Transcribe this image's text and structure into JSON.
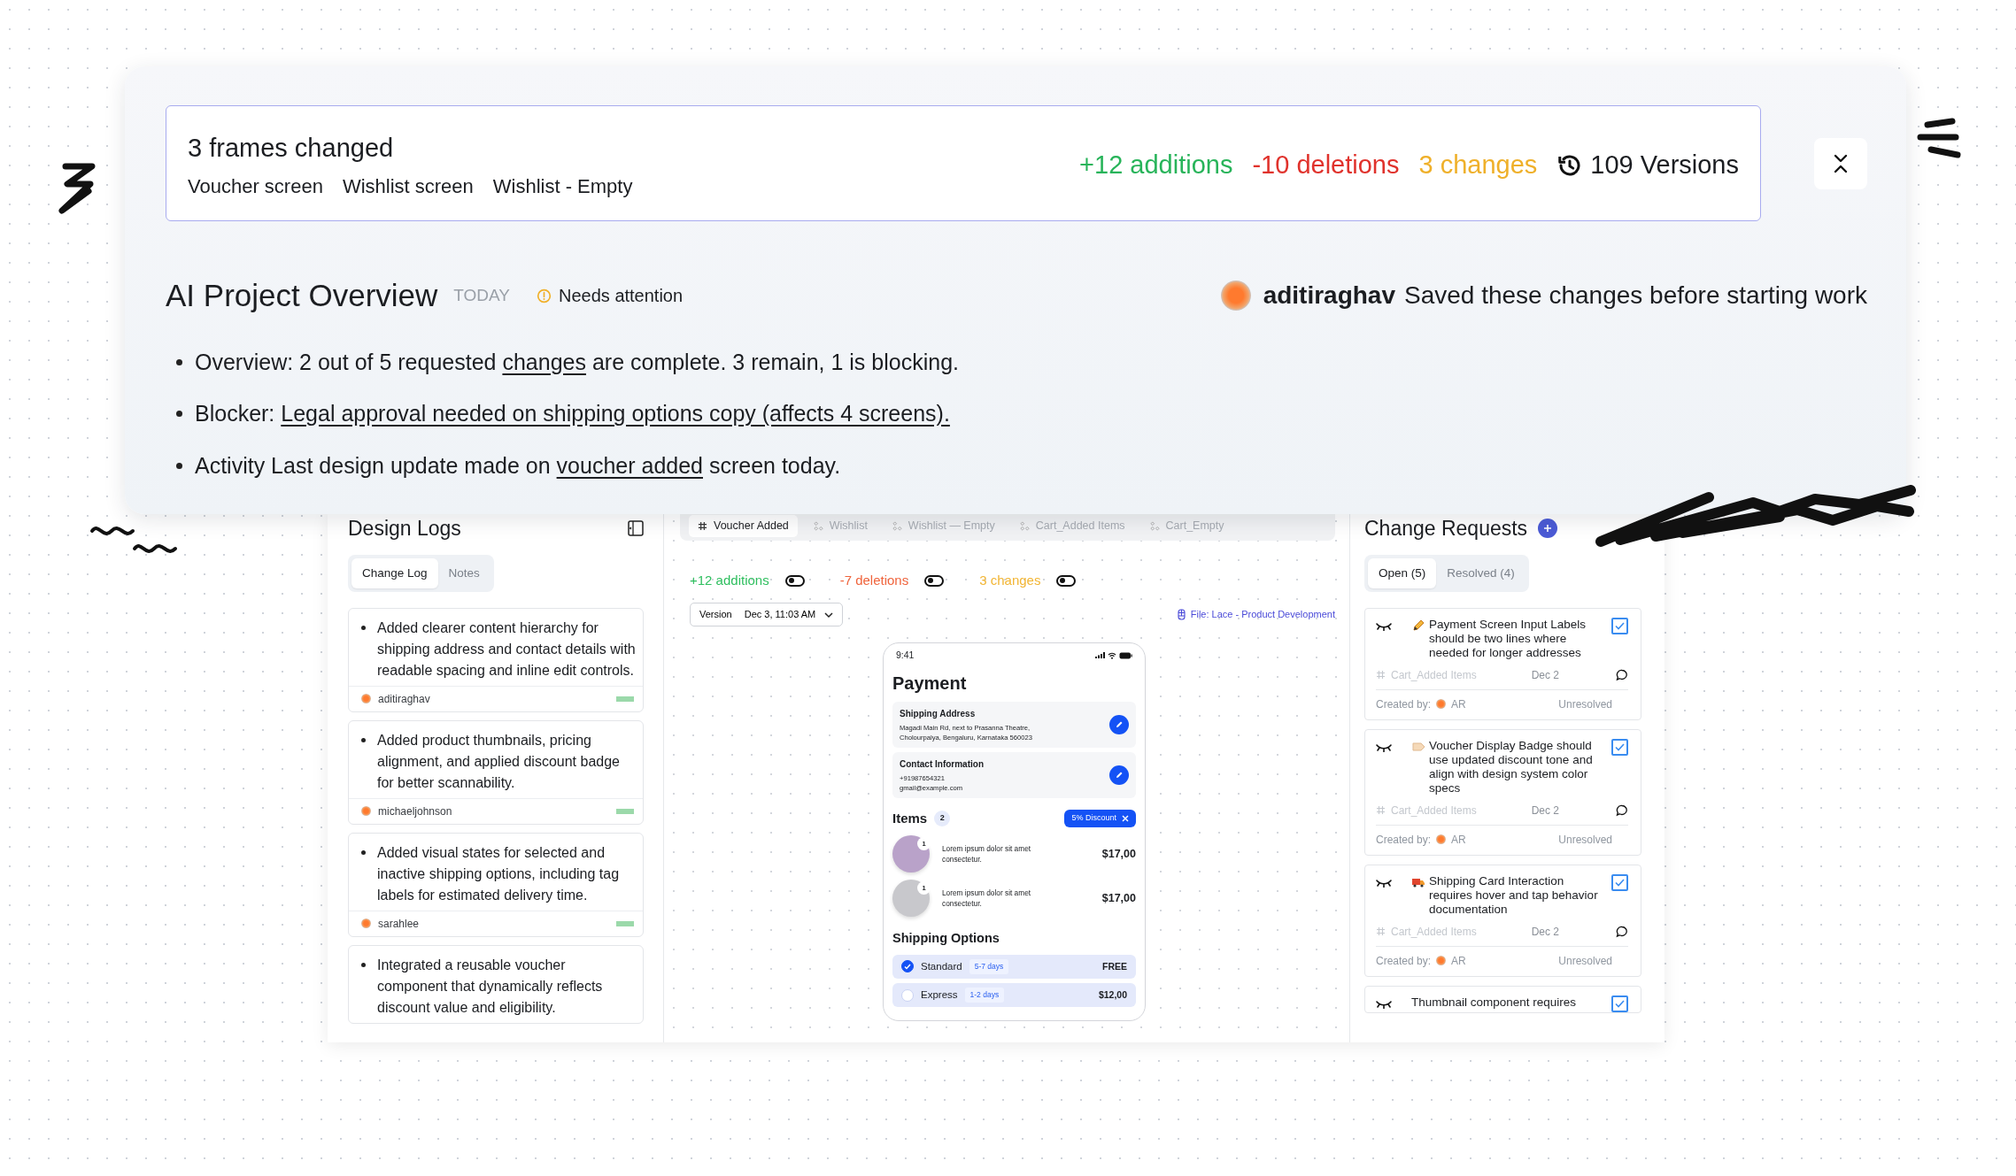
{
  "summary": {
    "title": "3 frames changed",
    "frames": [
      "Voucher screen",
      "Wishlist screen",
      "Wishlist - Empty"
    ],
    "stats": [
      {
        "kind": "additions",
        "text": "+12 additions"
      },
      {
        "kind": "deletions",
        "text": "-10 deletions"
      },
      {
        "kind": "changes",
        "text": "3 changes"
      }
    ],
    "versions": "109 Versions"
  },
  "overview": {
    "title": "AI Project Overview",
    "date": "TODAY",
    "status": "Needs attention",
    "author": "aditiraghav",
    "author_note": "Saved these changes before starting work",
    "bullets": [
      {
        "parts": [
          {
            "text": "Overview: 2 out of 5 requested ",
            "link": false
          },
          {
            "text": "changes",
            "link": true
          },
          {
            "text": " are complete. 3 remain, 1 is blocking.",
            "link": false
          }
        ]
      },
      {
        "parts": [
          {
            "text": "Blocker: ",
            "link": false
          },
          {
            "text": "Legal approval needed on shipping options copy (affects 4 screens).",
            "link": true
          }
        ]
      },
      {
        "parts": [
          {
            "text": "Activity Last design update made on ",
            "link": false
          },
          {
            "text": "voucher added",
            "link": true
          },
          {
            "text": " screen today.",
            "link": false
          }
        ]
      }
    ]
  },
  "design_logs": {
    "title": "Design Logs",
    "tabs": [
      {
        "label": "Change Log",
        "selected": true
      },
      {
        "label": "Notes",
        "selected": false
      }
    ],
    "entries": [
      {
        "text": "Added clearer content hierarchy for shipping address and contact details with readable spacing and inline edit controls.",
        "author": "aditiraghav"
      },
      {
        "text": "Added product thumbnails, pricing alignment, and applied discount badge for better scannability.",
        "author": "michaeljohnson"
      },
      {
        "text": "Added visual states for selected and inactive shipping options, including tag labels for estimated delivery time.",
        "author": "sarahlee"
      },
      {
        "text": "Integrated a reusable voucher component that dynamically reflects discount value and eligibility."
      }
    ]
  },
  "canvas": {
    "frame_tabs": [
      {
        "label": "Voucher Added",
        "selected": true
      },
      {
        "label": "Wishlist",
        "selected": false
      },
      {
        "label": "Wishlist — Empty",
        "selected": false
      },
      {
        "label": "Cart_Added Items",
        "selected": false
      },
      {
        "label": "Cart_Empty",
        "selected": false
      }
    ],
    "toggles": [
      {
        "kind": "additions",
        "label": "+12 additions",
        "on": false
      },
      {
        "kind": "deletions",
        "label": "-7 deletions",
        "on": false
      },
      {
        "kind": "changes",
        "label": "3 changes",
        "on": false
      }
    ],
    "version": {
      "label": "Version",
      "value": "Dec 3, 11:03 AM"
    },
    "file_link": "File: Lace - Product Development",
    "phone": {
      "time": "9:41",
      "title": "Payment",
      "cards": [
        {
          "title": "Shipping Address",
          "lines": [
            "Magadi Main Rd, next to Prasanna Theatre,",
            "Cholourpalya, Bengaluru, Karnataka 560023"
          ]
        },
        {
          "title": "Contact Information",
          "lines": [
            "+91987654321",
            "gmail@example.com"
          ]
        }
      ],
      "items_title": "Items",
      "items_count": "2",
      "discount": "5% Discount",
      "items": [
        {
          "qty": "1",
          "text": "Lorem ipsum dolor sit amet consectetur.",
          "price": "$17,00"
        },
        {
          "qty": "1",
          "text": "Lorem ipsum dolor sit amet consectetur.",
          "price": "$17,00"
        }
      ],
      "shipping_title": "Shipping Options",
      "shipping": [
        {
          "name": "Standard",
          "eta": "5-7 days",
          "price": "FREE",
          "selected": true
        },
        {
          "name": "Express",
          "eta": "1-2 days",
          "price": "$12,00",
          "selected": false
        }
      ]
    }
  },
  "change_requests": {
    "title": "Change Requests",
    "tabs": [
      {
        "label": "Open (5)",
        "selected": true
      },
      {
        "label": "Resolved (4)",
        "selected": false
      }
    ],
    "requests": [
      {
        "kind": "pencil",
        "title": "Payment Screen Input Labels should be two lines where needed for longer addresses",
        "checked": true,
        "frame": "Cart_Added Items",
        "date": "Dec 2",
        "created_label": "Created by:",
        "creator": "AR",
        "status": "Unresolved"
      },
      {
        "kind": "tag",
        "title": "Voucher Display Badge should use updated discount tone and align with design system color specs",
        "checked": true,
        "frame": "Cart_Added Items",
        "date": "Dec 2",
        "created_label": "Created by:",
        "creator": "AR",
        "status": "Unresolved"
      },
      {
        "kind": "truck",
        "title": "Shipping Card Interaction requires hover and tap behavior documentation",
        "checked": true,
        "frame": "Cart_Added Items",
        "date": "Dec 2",
        "created_label": "Created by:",
        "creator": "AR",
        "status": "Unresolved"
      },
      {
        "kind": "plain",
        "title": "Thumbnail component requires",
        "checked": true
      }
    ]
  }
}
